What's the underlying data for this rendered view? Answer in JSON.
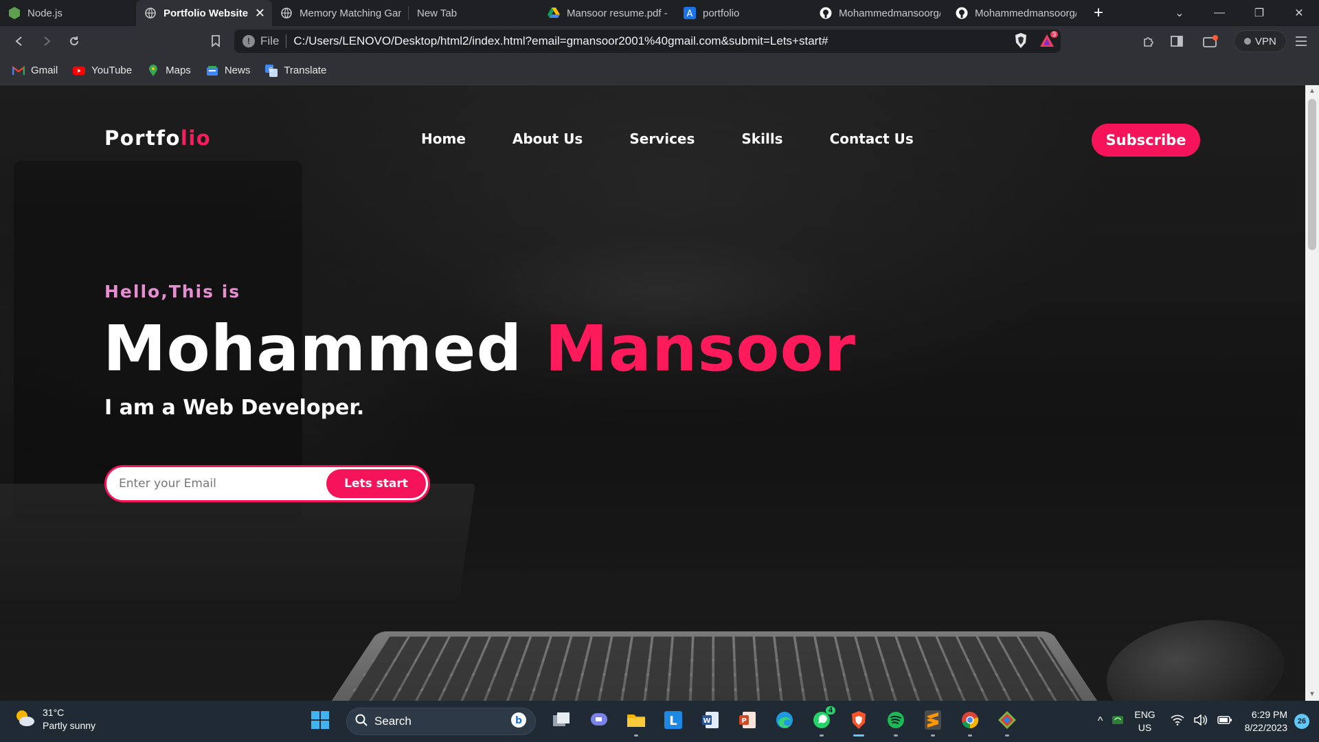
{
  "browser": {
    "tabs": [
      {
        "label": "Node.js",
        "icon": "nodejs-icon",
        "active": false
      },
      {
        "label": "Portfolio Website",
        "icon": "globe-icon",
        "active": true
      },
      {
        "label": "Memory Matching Gan",
        "icon": "globe-icon",
        "active": false
      },
      {
        "label": "New Tab",
        "icon": "",
        "active": false
      },
      {
        "label": "Mansoor resume.pdf -",
        "icon": "google-drive-icon",
        "active": false
      },
      {
        "label": "portfolio",
        "icon": "a-app-icon",
        "active": false
      },
      {
        "label": "Mohammedmansoorg/",
        "icon": "github-icon",
        "active": false
      },
      {
        "label": "Mohammedmansoorg/",
        "icon": "github-icon",
        "active": false
      }
    ],
    "address": {
      "scheme": "File",
      "url": "C:/Users/LENOVO/Desktop/html2/index.html?email=gmansoor2001%40gmail.com&submit=Lets+start#",
      "brave_badge": "3"
    },
    "vpn_label": "VPN",
    "bookmarks": [
      {
        "label": "Gmail",
        "icon": "gmail-icon"
      },
      {
        "label": "YouTube",
        "icon": "youtube-icon"
      },
      {
        "label": "Maps",
        "icon": "maps-icon"
      },
      {
        "label": "News",
        "icon": "news-icon"
      },
      {
        "label": "Translate",
        "icon": "translate-icon"
      }
    ]
  },
  "site": {
    "logo_main": "Portfo",
    "logo_accent": "lio",
    "nav": [
      "Home",
      "About Us",
      "Services",
      "Skills",
      "Contact Us"
    ],
    "subscribe_label": "Subscribe",
    "hello": "Hello,This is",
    "name_first": "Mohammed",
    "name_last": "Mansoor",
    "role": "I am a Web Developer.",
    "email_placeholder": "Enter your Email",
    "email_value": "",
    "cta_label": "Lets start",
    "accent_color": "#f5135a"
  },
  "taskbar": {
    "weather_temp": "31°C",
    "weather_desc": "Partly sunny",
    "search_label": "Search",
    "whatsapp_badge": "4",
    "lang_line1": "ENG",
    "lang_line2": "US",
    "time": "6:29 PM",
    "date": "8/22/2023",
    "notifications": "26"
  }
}
